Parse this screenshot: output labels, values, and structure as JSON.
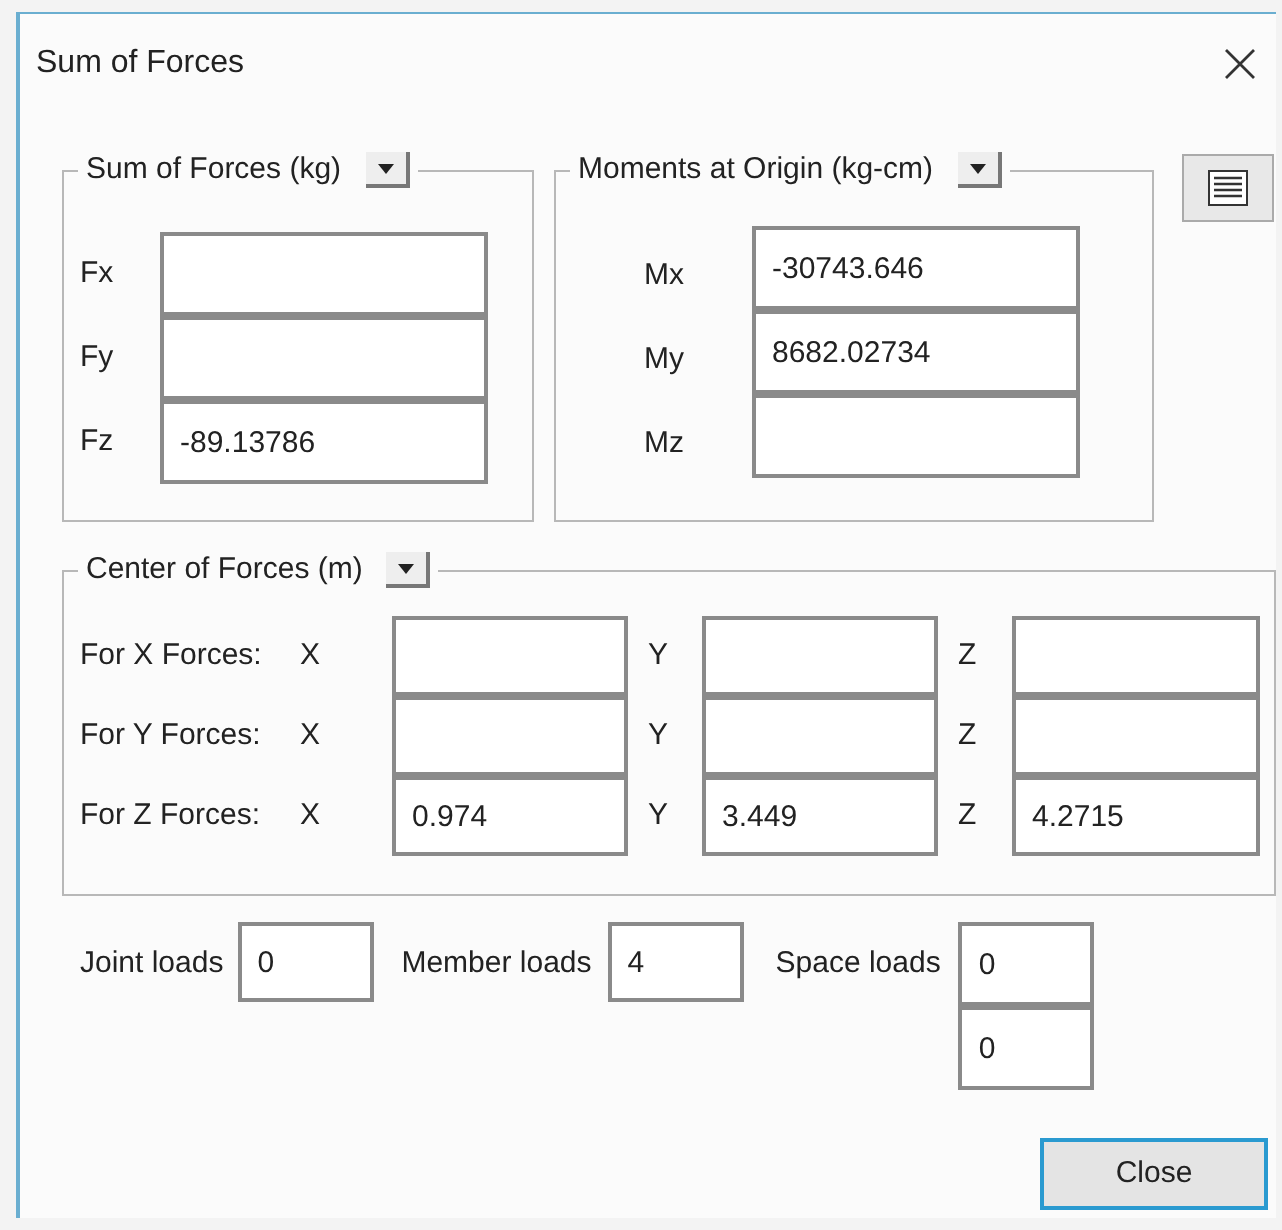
{
  "window": {
    "title": "Sum of Forces"
  },
  "forces": {
    "title": "Sum of Forces (kg)",
    "fields": [
      {
        "label": "Fx"
      },
      {
        "label": "Fy"
      },
      {
        "label": "Fz",
        "value": "-89.13786"
      }
    ]
  },
  "moments": {
    "title": "Moments at Origin (kg-cm)",
    "fields": [
      {
        "label": "Mx",
        "value": "-30743.646"
      },
      {
        "label": "My",
        "value": "8682.02734"
      },
      {
        "label": "Mz"
      }
    ]
  },
  "center": {
    "title": "Center of Forces (m)",
    "rows": [
      {
        "label": "For X Forces:",
        "cells": [
          {
            "axis": "X"
          },
          {
            "axis": "Y"
          },
          {
            "axis": "Z"
          }
        ]
      },
      {
        "label": "For Y Forces:",
        "cells": [
          {
            "axis": "X"
          },
          {
            "axis": "Y"
          },
          {
            "axis": "Z"
          }
        ]
      },
      {
        "label": "For Z Forces:",
        "cells": [
          {
            "axis": "X",
            "value": "0.974"
          },
          {
            "axis": "Y",
            "value": "3.449"
          },
          {
            "axis": "Z",
            "value": "4.2715"
          }
        ]
      }
    ]
  },
  "loads": {
    "joint": {
      "label": "Joint loads",
      "value": "0"
    },
    "member": {
      "label": "Member loads",
      "value": "4"
    },
    "space": {
      "label": "Space loads",
      "values": [
        "0",
        "0"
      ]
    }
  },
  "buttons": {
    "close": "Close"
  }
}
